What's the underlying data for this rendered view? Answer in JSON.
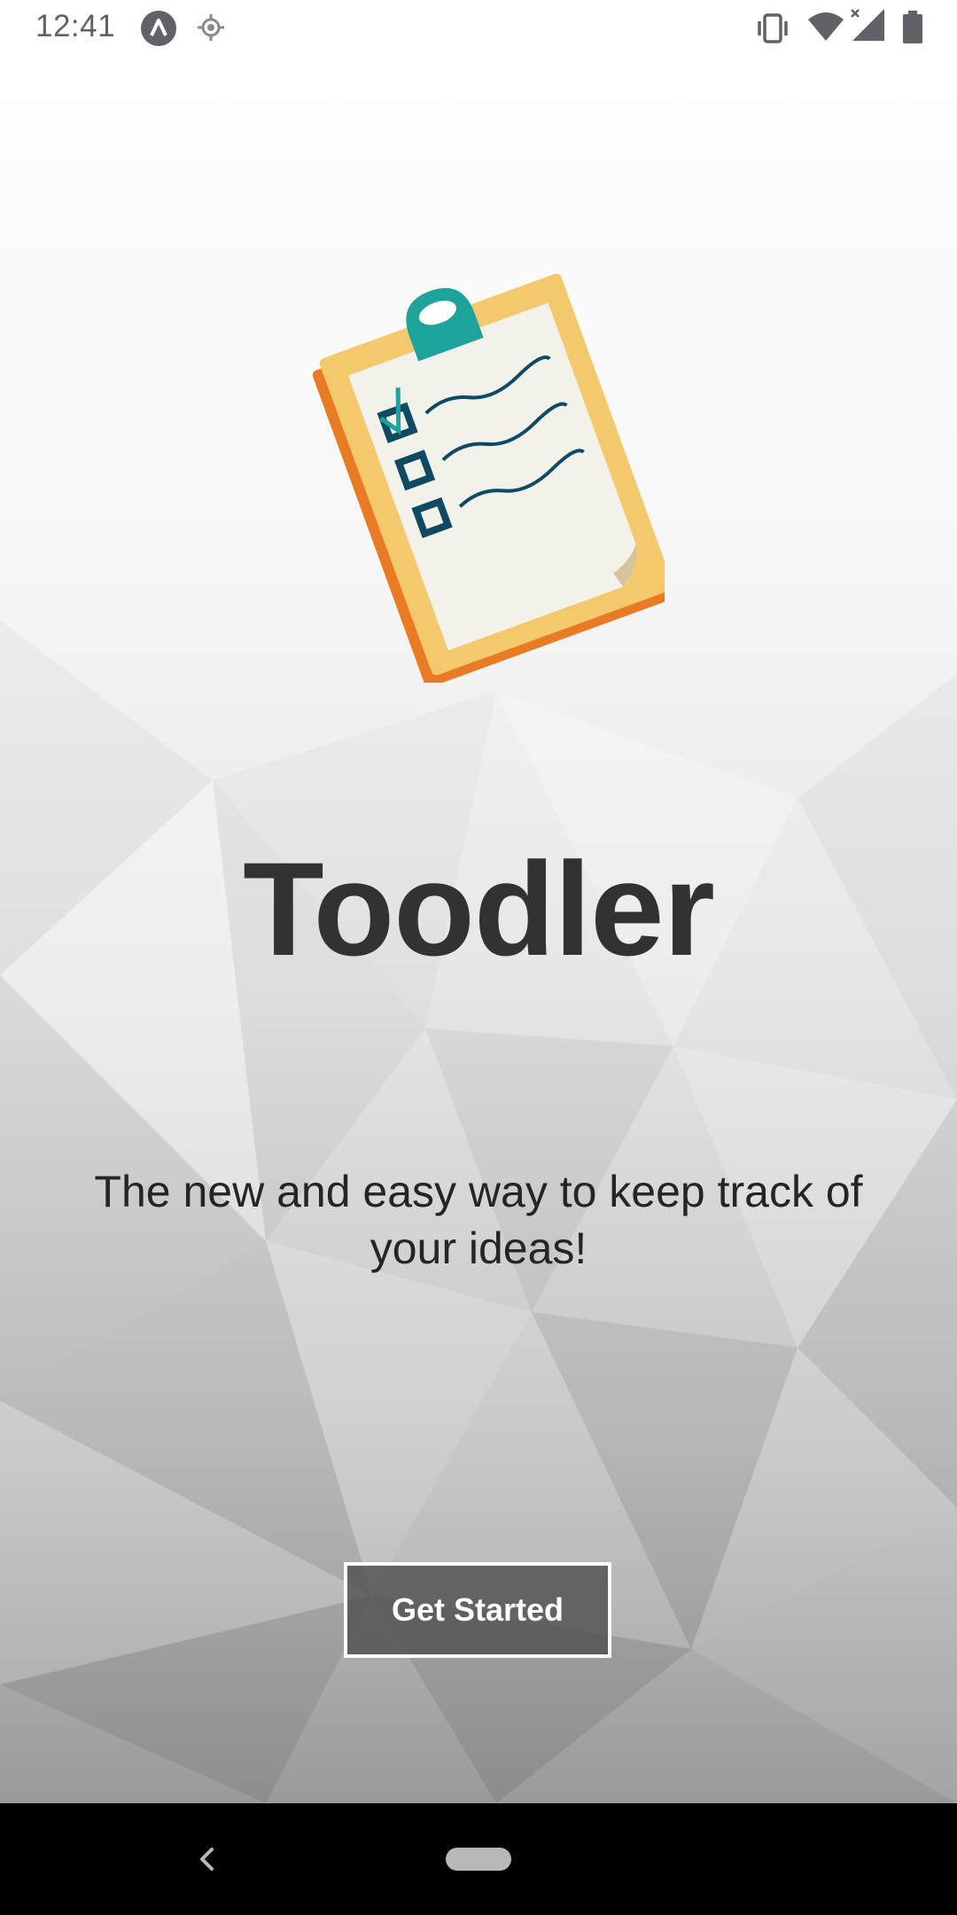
{
  "status_bar": {
    "time": "12:41",
    "icons": [
      "app-a-icon",
      "location-icon",
      "vibrate-icon",
      "wifi-icon",
      "signal-icon",
      "battery-icon"
    ]
  },
  "logo": {
    "icon": "clipboard-checklist-icon",
    "colors": {
      "board": "#f4c96e",
      "board_edge": "#e87b24",
      "paper": "#f2f1ea",
      "clip": "#1ba39c",
      "ink": "#0e4a63"
    }
  },
  "app": {
    "title": "Toodler",
    "tagline": "The new and easy way to keep track of your ideas!",
    "cta_label": "Get Started"
  },
  "nav_bar": {
    "icons": [
      "back-icon",
      "home-pill-icon"
    ]
  }
}
